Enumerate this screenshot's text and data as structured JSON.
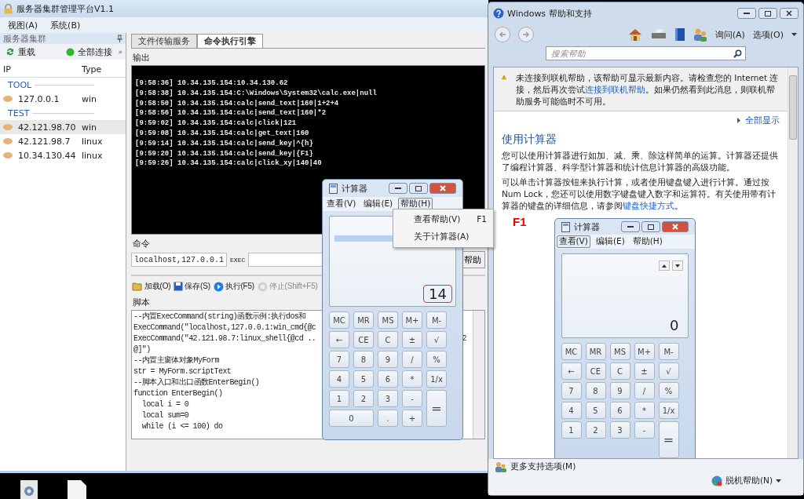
{
  "main_window": {
    "title": "服务器集群管理平台V1.1",
    "menu": [
      "视图(A)",
      "系统(B)"
    ],
    "sidebar": {
      "title": "服务器集群",
      "toolbar": [
        {
          "label": "重载",
          "kind": "refresh"
        },
        {
          "label": "全部连接",
          "kind": "connect"
        }
      ],
      "overflow": "»",
      "columns": [
        "IP",
        "Type"
      ],
      "groups": [
        {
          "name": "TOOL",
          "rows": [
            {
              "ip": "127.0.0.1",
              "type": "win",
              "selected": false
            }
          ]
        },
        {
          "name": "TEST",
          "rows": [
            {
              "ip": "42.121.98.70",
              "type": "win",
              "selected": true
            },
            {
              "ip": "42.121.98.7",
              "type": "linux",
              "selected": false
            },
            {
              "ip": "10.34.130.44",
              "type": "linux",
              "selected": false
            }
          ]
        }
      ]
    },
    "tabs": [
      {
        "label": "文件传输服务",
        "selected": false
      },
      {
        "label": "命令执行引擎",
        "selected": true
      }
    ],
    "output": {
      "label": "输出",
      "lines": [
        "[9:58:36] 10.34.135.154:10.34.130.62",
        "[9:58:38] 10.34.135.154:C:\\Windows\\System32\\calc.exe|null",
        "[9:58:50] 10.34.135.154:calc|send_text|160|1+2+4",
        "[9:58:56] 10.34.135.154:calc|send_text|160|*2",
        "[9:59:02] 10.34.135.154:calc|click|121",
        "[9:59:08] 10.34.135.154:calc|get_text|160",
        "[9:59:14] 10.34.135.154:calc|send_key|^{h}",
        "[9:59:20] 10.34.135.154:calc|send_key|{F1}",
        "[9:59:26] 10.34.135.154:calc|click_xy|140|40"
      ]
    },
    "command": {
      "label": "命令",
      "target": "localhost,127.0.0.1",
      "exec_label": "EXEC",
      "help_button": "帮助"
    },
    "script_toolbar": [
      {
        "label": "加载(O)",
        "kind": "open",
        "disabled": false
      },
      {
        "label": "保存(S)",
        "kind": "save",
        "disabled": false
      },
      {
        "label": "执行(F5)",
        "kind": "run",
        "disabled": false
      },
      {
        "label": "停止(Shift+F5)",
        "kind": "stop",
        "disabled": true
      }
    ],
    "script": {
      "label": "脚本",
      "lines": [
        {
          "text": "--内置ExecCommand(string)函数示例:执行dos和"
        },
        {
          "text": "ExecCommand(\"localhost,127.0.0.1:win_cmd{@c"
        },
        {
          "text": "ExecCommand(\"42.121.98.7:linux_shell{@cd ..",
          "tail": "2"
        },
        {
          "text": "@]\")"
        },
        {
          "text": "--内置主窗体对象MyForm"
        },
        {
          "text": "str = MyForm.scriptText"
        },
        {
          "text": "--脚本入口和出口函数EnterBegin()"
        },
        {
          "text": "function EnterBegin()"
        },
        {
          "text": "  local i = 0"
        },
        {
          "text": "  local sum=0"
        },
        {
          "text": "  while (i <= 100) do"
        }
      ]
    }
  },
  "calculator": {
    "title": "计算器",
    "menu": [
      {
        "label": "查看(V)",
        "selected": false
      },
      {
        "label": "编辑(E)",
        "selected": false
      },
      {
        "label": "帮助(H)",
        "selected": true
      }
    ],
    "open_menu": [
      {
        "label": "查看帮助(V)",
        "shortcut": "F1"
      },
      {
        "label": "关于计算器(A)"
      }
    ],
    "display": "14",
    "display_highlighted": true,
    "keys": [
      {
        "label": "MC",
        "kind": "key"
      },
      {
        "label": "MR",
        "kind": "key"
      },
      {
        "label": "MS",
        "kind": "key"
      },
      {
        "label": "M+",
        "kind": "key"
      },
      {
        "label": "M-",
        "kind": "key"
      },
      {
        "label": "←",
        "kind": "key"
      },
      {
        "label": "CE",
        "kind": "key"
      },
      {
        "label": "C",
        "kind": "key"
      },
      {
        "label": "±",
        "kind": "key"
      },
      {
        "label": "√",
        "kind": "key"
      },
      {
        "label": "7",
        "kind": "key"
      },
      {
        "label": "8",
        "kind": "key"
      },
      {
        "label": "9",
        "kind": "key"
      },
      {
        "label": "/",
        "kind": "key"
      },
      {
        "label": "%",
        "kind": "key"
      },
      {
        "label": "4",
        "kind": "key"
      },
      {
        "label": "5",
        "kind": "key"
      },
      {
        "label": "6",
        "kind": "key"
      },
      {
        "label": "*",
        "kind": "key"
      },
      {
        "label": "1/x",
        "kind": "key"
      },
      {
        "label": "1",
        "kind": "key"
      },
      {
        "label": "2",
        "kind": "key"
      },
      {
        "label": "3",
        "kind": "key"
      },
      {
        "label": "-",
        "kind": "key"
      },
      {
        "label": "=",
        "kind": "tall"
      },
      {
        "label": "0",
        "kind": "wide"
      },
      {
        "label": ".",
        "kind": "key"
      },
      {
        "label": "+",
        "kind": "key"
      }
    ]
  },
  "help_window": {
    "title": "Windows 帮助和支持",
    "toolbar": [
      "询问(A)",
      "选项(O)"
    ],
    "search": {
      "placeholder": "搜索帮助"
    },
    "warning": {
      "before": "未连接到联机帮助，该帮助可显示最新内容。请检查您的 Internet 连接，然后再次尝试",
      "link": "连接到联机帮助",
      "after": "。如果仍然看到此消息，则联机帮助服务可能临时不可用。"
    },
    "show_all": "全部显示",
    "heading": "使用计算器",
    "paragraphs": [
      {
        "before": "您可以使用计算器进行如加、减、乘、除这样简单的运算。计算器还提供了编程计算器、科学型计算器和统计信息计算器的高级功能。"
      },
      {
        "before": "可以单击计算器按钮来执行计算，或者使用键盘键入进行计算。通过按 Num Lock，您还可以使用数字键盘键入数字和运算符。有关使用带有计算器的键盘的详细信息，请参阅",
        "link": "键盘快捷方式",
        "after": "。"
      }
    ],
    "annotation": "F1",
    "embedded_calculator": {
      "title": "计算器",
      "menu": [
        {
          "label": "查看(V)",
          "selected": true
        },
        {
          "label": "编辑(E)",
          "selected": false
        },
        {
          "label": "帮助(H)",
          "selected": false
        }
      ],
      "display": "0",
      "display_highlighted": false,
      "keys": [
        {
          "label": "MC",
          "kind": "key"
        },
        {
          "label": "MR",
          "kind": "key"
        },
        {
          "label": "MS",
          "kind": "key"
        },
        {
          "label": "M+",
          "kind": "key"
        },
        {
          "label": "M-",
          "kind": "key"
        },
        {
          "label": "←",
          "kind": "key"
        },
        {
          "label": "CE",
          "kind": "key"
        },
        {
          "label": "C",
          "kind": "key"
        },
        {
          "label": "±",
          "kind": "key"
        },
        {
          "label": "√",
          "kind": "key"
        },
        {
          "label": "7",
          "kind": "key"
        },
        {
          "label": "8",
          "kind": "key"
        },
        {
          "label": "9",
          "kind": "key"
        },
        {
          "label": "/",
          "kind": "key"
        },
        {
          "label": "%",
          "kind": "key"
        },
        {
          "label": "4",
          "kind": "key"
        },
        {
          "label": "5",
          "kind": "key"
        },
        {
          "label": "6",
          "kind": "key"
        },
        {
          "label": "*",
          "kind": "key"
        },
        {
          "label": "1/x",
          "kind": "key"
        },
        {
          "label": "1",
          "kind": "key"
        },
        {
          "label": "2",
          "kind": "key"
        },
        {
          "label": "3",
          "kind": "key"
        },
        {
          "label": "-",
          "kind": "key"
        },
        {
          "label": "=",
          "kind": "tall"
        }
      ]
    },
    "footer": {
      "more": "更多支持选项(M)",
      "offline": "脱机帮助(N)"
    }
  }
}
